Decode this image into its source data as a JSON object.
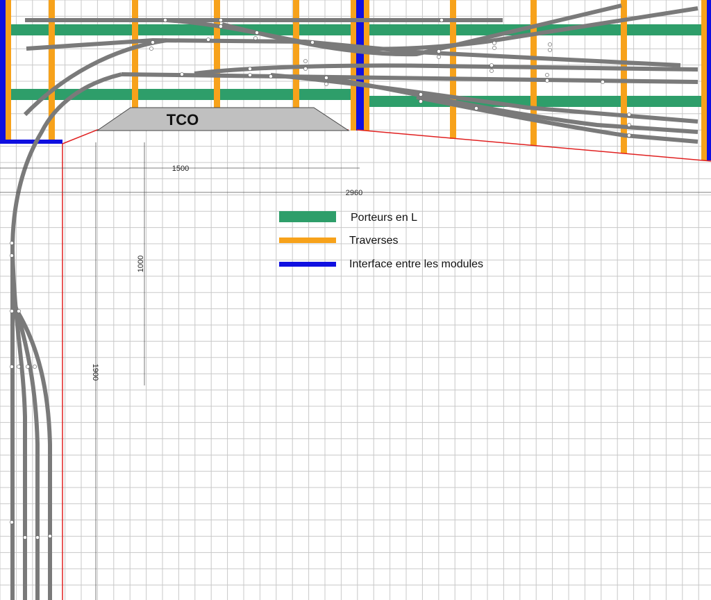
{
  "diagram": {
    "panel_label": "TCO",
    "dimensions": {
      "top_width_short": "1500",
      "top_width_total": "2960",
      "left_height": "1900",
      "inner_height": "1000"
    },
    "legend": [
      {
        "label": "Porteurs en L",
        "color": "#2e9e6a"
      },
      {
        "label": "Traverses",
        "color": "#f7a21b"
      },
      {
        "label": "Interface entre les modules",
        "color": "#1010e0"
      }
    ],
    "colors": {
      "grid": "#c8c8c8",
      "porteurs": "#2e9e6a",
      "traverses": "#f7a21b",
      "interface": "#1010e0",
      "outline": "#e02020",
      "track": "#7a7a7a",
      "panel": "#c0c0c0"
    }
  }
}
